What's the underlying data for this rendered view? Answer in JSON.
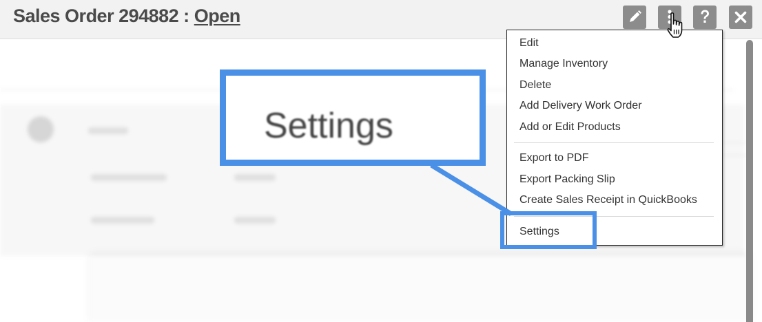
{
  "header": {
    "title": "Sales Order 294882 :",
    "status": "Open",
    "buttons": {
      "edit": "pencil-icon",
      "more": "vertical-dots-icon",
      "help": "question-icon",
      "close": "close-icon"
    }
  },
  "menu": {
    "group1": [
      "Edit",
      "Manage Inventory",
      "Delete",
      "Add Delivery Work Order",
      "Add or Edit Products"
    ],
    "group2": [
      "Export to PDF",
      "Export Packing Slip",
      "Create Sales Receipt in QuickBooks"
    ],
    "group3": [
      "Settings"
    ]
  },
  "callout": {
    "zoom_text": "Settings"
  },
  "colors": {
    "highlight": "#4a90e6",
    "header_bg": "#f2f2f2",
    "icon_button": "#8c8c8c",
    "title_text": "#4a4a4a"
  }
}
